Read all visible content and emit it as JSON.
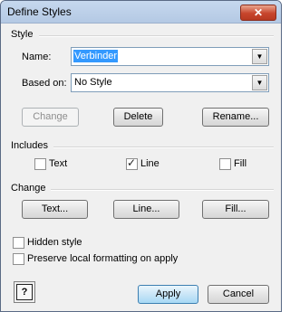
{
  "window": {
    "title": "Define Styles",
    "close_glyph": "✕"
  },
  "style_section": {
    "label": "Style",
    "name_label": "Name:",
    "name_value": "Verbinder",
    "based_on_label": "Based on:",
    "based_on_value": "No Style",
    "change_button": "Change",
    "delete_button": "Delete",
    "rename_button": "Rename..."
  },
  "includes_section": {
    "label": "Includes",
    "text": {
      "label": "Text",
      "checked": false
    },
    "line": {
      "label": "Line",
      "checked": true
    },
    "fill": {
      "label": "Fill",
      "checked": false
    }
  },
  "change_section": {
    "label": "Change",
    "text_button": "Text...",
    "line_button": "Line...",
    "fill_button": "Fill..."
  },
  "options": {
    "hidden_style": {
      "label": "Hidden style",
      "checked": false
    },
    "preserve_local": {
      "label": "Preserve local formatting on apply",
      "checked": false
    }
  },
  "footer": {
    "help_glyph": "?",
    "apply_button": "Apply",
    "cancel_button": "Cancel"
  },
  "icons": {
    "dropdown": "chevron-down-icon",
    "check": "✓",
    "arrow": "▼"
  }
}
